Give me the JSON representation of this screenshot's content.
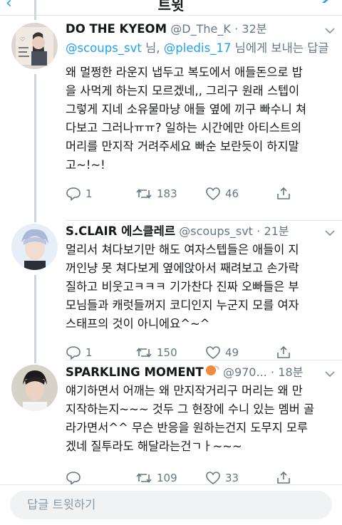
{
  "header": {
    "title": "트윗",
    "back_icon": "back-arrow-icon",
    "compose_icon": "compose-feather-icon"
  },
  "tweets": [
    {
      "name": "DO THE KYEOM",
      "handle": "@D_The_K",
      "dot": "·",
      "time": "32분",
      "reply_to": {
        "m1": "@scoups_svt",
        "sep1": " 님, ",
        "m2": "@pledis_17",
        "suffix": " 님에게 보내는 답글"
      },
      "lines": [
        "왜 멀쩡한 라운지 냅두고 복도에서 애들돈으로 밥",
        "을 사먹게 하는지 모르겠네,, 그리구 원래 스텝이",
        "그렇게 지네 소유물마냥 애들 옆에 끼구 빠수니 쳐",
        "다보고 그러나ㅠㅠ? 일하는 시간에만 아티스트의",
        "머리를 만지작 거려주세요 빠순 보란듯이 하지말",
        "고~!~!"
      ],
      "stats": {
        "replies": "1",
        "retweets": "183",
        "likes": "46"
      }
    },
    {
      "name": "S.CLAIR 에스클레르",
      "handle": "@scoups_svt",
      "dot": "·",
      "time": "21분",
      "lines": [
        "멀리서 쳐다보기만 해도 여자스텝들은 애들이 지",
        "꺼인냥 못 쳐다보게 옆에앉아서 째려보고 손가락",
        "질하고 비웃고ㅋㅋㅋ 기가찬다 진짜 오빠들은 부",
        "모님들과 캐럿들꺼지 코디인지 누군지 모를 여자",
        "스태프의 것이 아니에요^~^"
      ],
      "stats": {
        "replies": "1",
        "retweets": "150",
        "likes": "49"
      }
    },
    {
      "name": "SPARKLING MOMENT",
      "handle": "@970...",
      "dot": "·",
      "time": "18분",
      "lines": [
        "얘기하면서 어깨는 왜 만지작거리구 머리는 왜 만",
        "지작하는지~~~ 것두 그 현장에 수니 있는 멤버 골",
        "라가면서^^ 무슨 반응을 원하는건지 도무지 모루",
        "겠네 질투라도 해달라는건ㄱㅏ~~~"
      ],
      "stats": {
        "replies": "",
        "retweets": "109",
        "likes": "33"
      }
    }
  ],
  "reply_box": {
    "placeholder": "답글 트윗하기"
  },
  "colors": {
    "accent": "#1da1f2",
    "muted": "#657786",
    "text": "#14171a",
    "divider": "#e1e8ed",
    "thread_line": "#cdd6dd"
  }
}
